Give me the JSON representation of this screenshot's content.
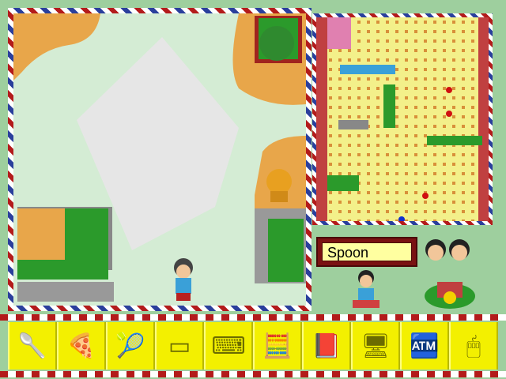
{
  "current_item": "Spoon",
  "tools": [
    {
      "name": "spoon-icon",
      "glyph": "🥄"
    },
    {
      "name": "pizza-icon",
      "glyph": "🍕"
    },
    {
      "name": "tennis-racket-icon",
      "glyph": "🎾"
    },
    {
      "name": "eraser-icon",
      "glyph": "▭"
    },
    {
      "name": "keyboard-icon",
      "glyph": "⌨"
    },
    {
      "name": "calculator-icon",
      "glyph": "🧮"
    },
    {
      "name": "book-icon",
      "glyph": "📕"
    },
    {
      "name": "monitor-icon",
      "glyph": "🖥"
    },
    {
      "name": "cash-register-icon",
      "glyph": "🏧"
    },
    {
      "name": "mouse-icon",
      "glyph": "🖱"
    }
  ]
}
